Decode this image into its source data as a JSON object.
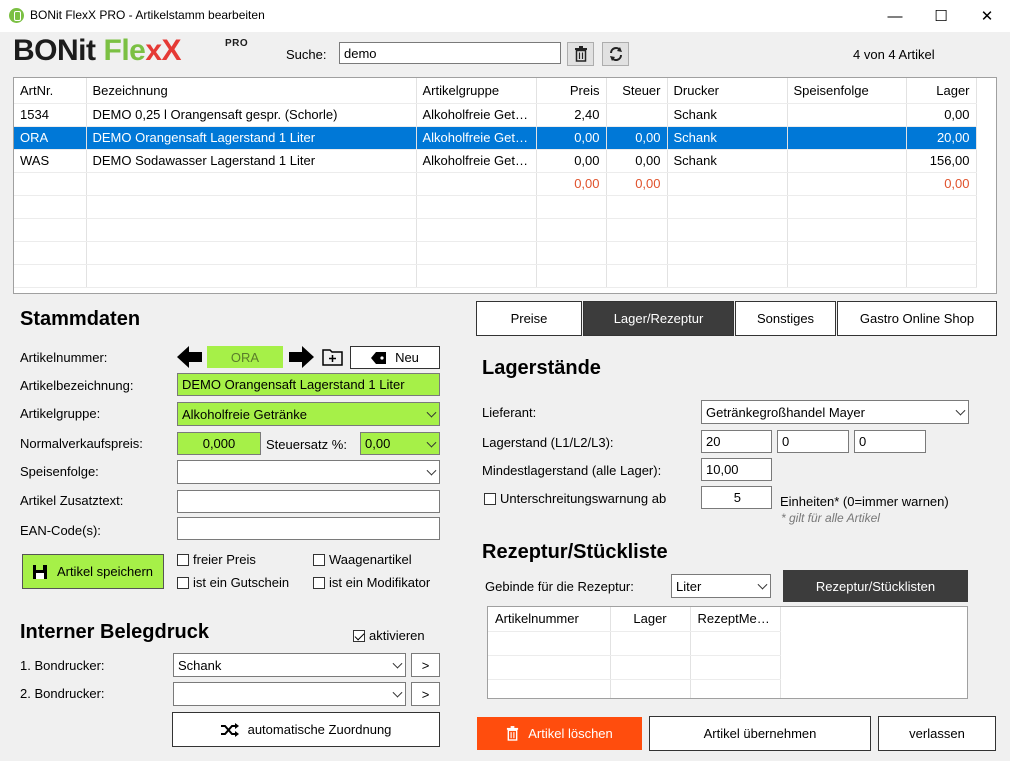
{
  "window": {
    "title": "BONit FlexX PRO - Artikelstamm bearbeiten",
    "minimize": "—",
    "maximize": "☐",
    "close": "✕"
  },
  "logo": {
    "part1": "BONit",
    "part2": "Fle",
    "part3": "xX",
    "pro": "PRO"
  },
  "search": {
    "label": "Suche:",
    "value": "demo",
    "count": "4 von 4 Artikel"
  },
  "grid": {
    "columns": [
      "ArtNr.",
      "Bezeichnung",
      "Artikelgruppe",
      "Preis",
      "Steuer",
      "Drucker",
      "Speisenfolge",
      "Lager"
    ],
    "rows": [
      [
        "1534",
        "DEMO 0,25 l Orangensaft gespr. (Schorle)",
        "Alkoholfreie Getränke",
        "2,40",
        "",
        "Schank",
        "",
        "0,00"
      ],
      [
        "ORA",
        "DEMO Orangensaft Lagerstand 1 Liter",
        "Alkoholfreie Getränke",
        "0,00",
        "0,00",
        "Schank",
        "",
        "20,00"
      ],
      [
        "WAS",
        "DEMO Sodawasser Lagerstand 1 Liter",
        "Alkoholfreie Getränke",
        "0,00",
        "0,00",
        "Schank",
        "",
        "156,00"
      ],
      [
        "",
        "",
        "",
        "0,00",
        "0,00",
        "",
        "",
        "0,00"
      ]
    ]
  },
  "stammdaten": {
    "heading": "Stammdaten",
    "artnr_label": "Artikelnummer:",
    "artnr_value": "ORA",
    "new_label": "Neu",
    "bez_label": "Artikelbezeichnung:",
    "bez_value": "DEMO Orangensaft Lagerstand 1 Liter",
    "gruppe_label": "Artikelgruppe:",
    "gruppe_value": "Alkoholfreie Getränke",
    "preis_label": "Normalverkaufspreis:",
    "preis_value": "0,000",
    "steuer_label": "Steuersatz %:",
    "steuer_value": "0,00",
    "speisen_label": "Speisenfolge:",
    "speisen_value": "",
    "zusatz_label": "Artikel Zusatztext:",
    "zusatz_value": "",
    "ean_label": "EAN-Code(s):",
    "ean_value": "",
    "save_label": "Artikel speichern",
    "freier_preis": "freier Preis",
    "gutschein": "ist ein Gutschein",
    "waage": "Waagenartikel",
    "modifikator": "ist ein Modifikator"
  },
  "beleg": {
    "heading": "Interner Belegdruck",
    "aktivieren": "aktivieren",
    "drucker1_label": "1. Bondrucker:",
    "drucker1_value": "Schank",
    "drucker2_label": "2. Bondrucker:",
    "drucker2_value": "",
    "more": ">",
    "auto_label": "automatische Zuordnung"
  },
  "tabs": {
    "preise": "Preise",
    "lager": "Lager/Rezeptur",
    "sonstiges": "Sonstiges",
    "shop": "Gastro Online Shop"
  },
  "lager": {
    "heading": "Lagerstände",
    "lieferant_label": "Lieferant:",
    "lieferant_value": "Getränkegroßhandel Mayer",
    "stand_label": "Lagerstand (L1/L2/L3):",
    "l1": "20",
    "l2": "0",
    "l3": "0",
    "min_label": "Mindestlagerstand (alle Lager):",
    "min_value": "10,00",
    "warn_label": "Unterschreitungswarnung ab",
    "warn_value": "5",
    "einheiten": "Einheiten* (0=immer warnen)",
    "note": "* gilt für alle Artikel"
  },
  "rezeptur": {
    "heading": "Rezeptur/Stückliste",
    "gebinde_label": "Gebinde für die Rezeptur:",
    "gebinde_value": "Liter",
    "button": "Rezeptur/Stücklisten",
    "columns": [
      "Artikelnummer",
      "Lager",
      "RezeptMenge"
    ]
  },
  "actions": {
    "delete": "Artikel löschen",
    "apply": "Artikel übernehmen",
    "exit": "verlassen"
  },
  "colors": {
    "accent_green": "#a6f048",
    "selection": "#0078d7",
    "delete": "#ff4d0d",
    "tab_active": "#3c3c3c"
  }
}
